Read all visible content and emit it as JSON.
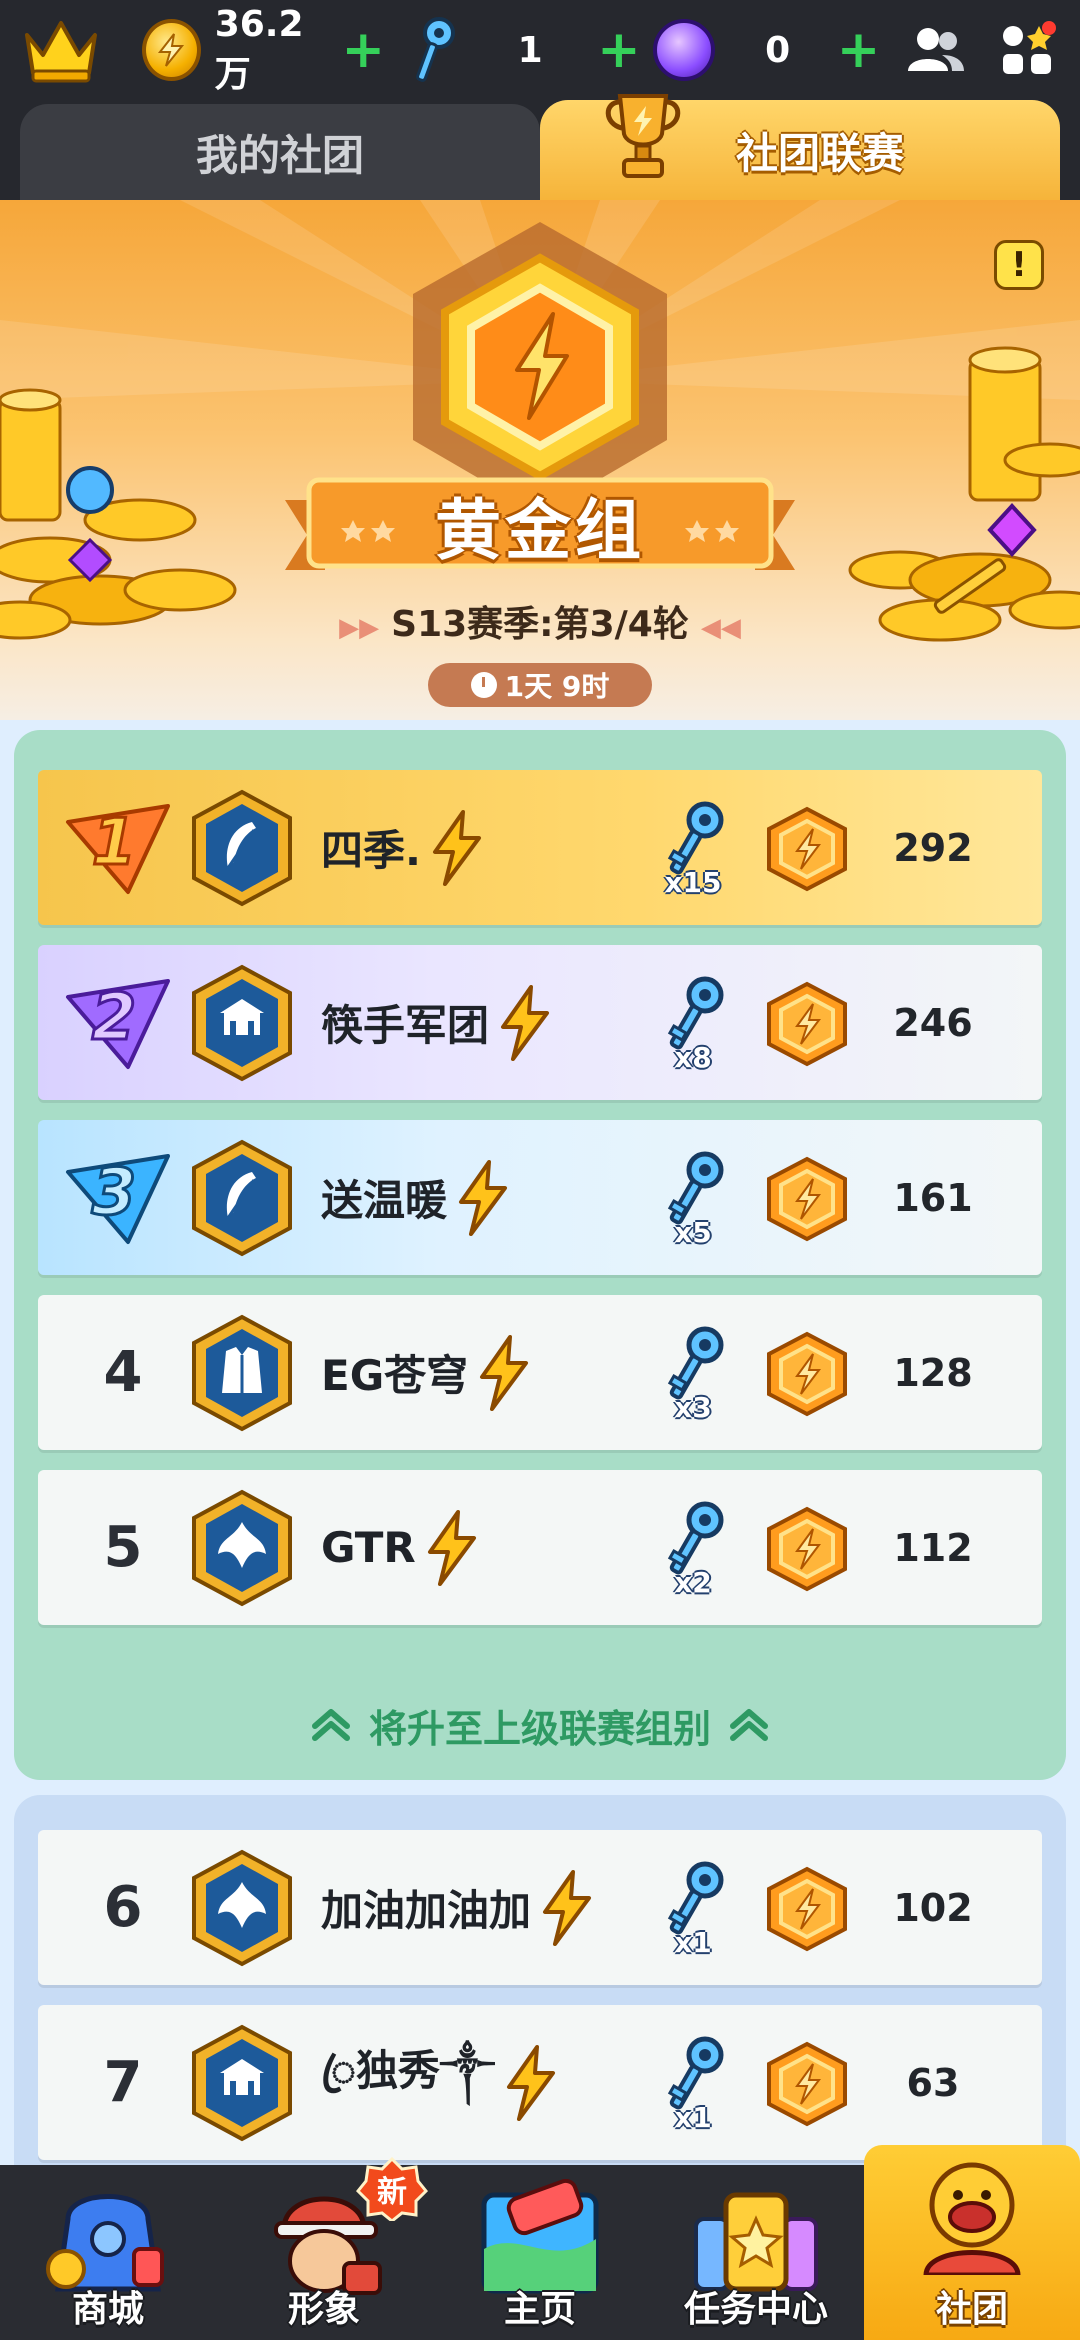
{
  "topbar": {
    "coins": "36.2万",
    "keys": "1",
    "gems": "0"
  },
  "tabs": [
    {
      "label": "我的社团",
      "active": false
    },
    {
      "label": "社团联赛",
      "active": true
    }
  ],
  "league": {
    "group": "黄金组",
    "season": "S13赛季:第3/4轮",
    "timer": "1天 9时",
    "info_label": "!"
  },
  "rankings": [
    {
      "rank": "1",
      "name": "四季.",
      "keys": "x15",
      "points": "292",
      "style": "gold"
    },
    {
      "rank": "2",
      "name": "筷手军团",
      "keys": "x8",
      "points": "246",
      "style": "silver"
    },
    {
      "rank": "3",
      "name": "送温暖",
      "keys": "x5",
      "points": "161",
      "style": "bronze"
    },
    {
      "rank": "4",
      "name": "EG苍穹",
      "keys": "x3",
      "points": "128",
      "style": "plain"
    },
    {
      "rank": "5",
      "name": "GTR",
      "keys": "x2",
      "points": "112",
      "style": "plain"
    },
    {
      "rank": "6",
      "name": "加油加油加",
      "keys": "x1",
      "points": "102",
      "style": "plain"
    },
    {
      "rank": "7",
      "name": "ꦿ独秀༒",
      "keys": "x1",
      "points": "63",
      "style": "plain"
    }
  ],
  "promotion_note": "将升至上级联赛组别",
  "bottom_nav": [
    {
      "label": "商城",
      "active": false
    },
    {
      "label": "形象",
      "active": false,
      "badge": "新"
    },
    {
      "label": "主页",
      "active": false
    },
    {
      "label": "任务中心",
      "active": false
    },
    {
      "label": "社团",
      "active": true
    }
  ],
  "colors": {
    "accent_gold": "#f6b43a",
    "promo_green": "#2e9a63",
    "panel_green": "#a8ddc7",
    "panel_blue": "#c8dcf5",
    "plus_green": "#35d05a"
  }
}
